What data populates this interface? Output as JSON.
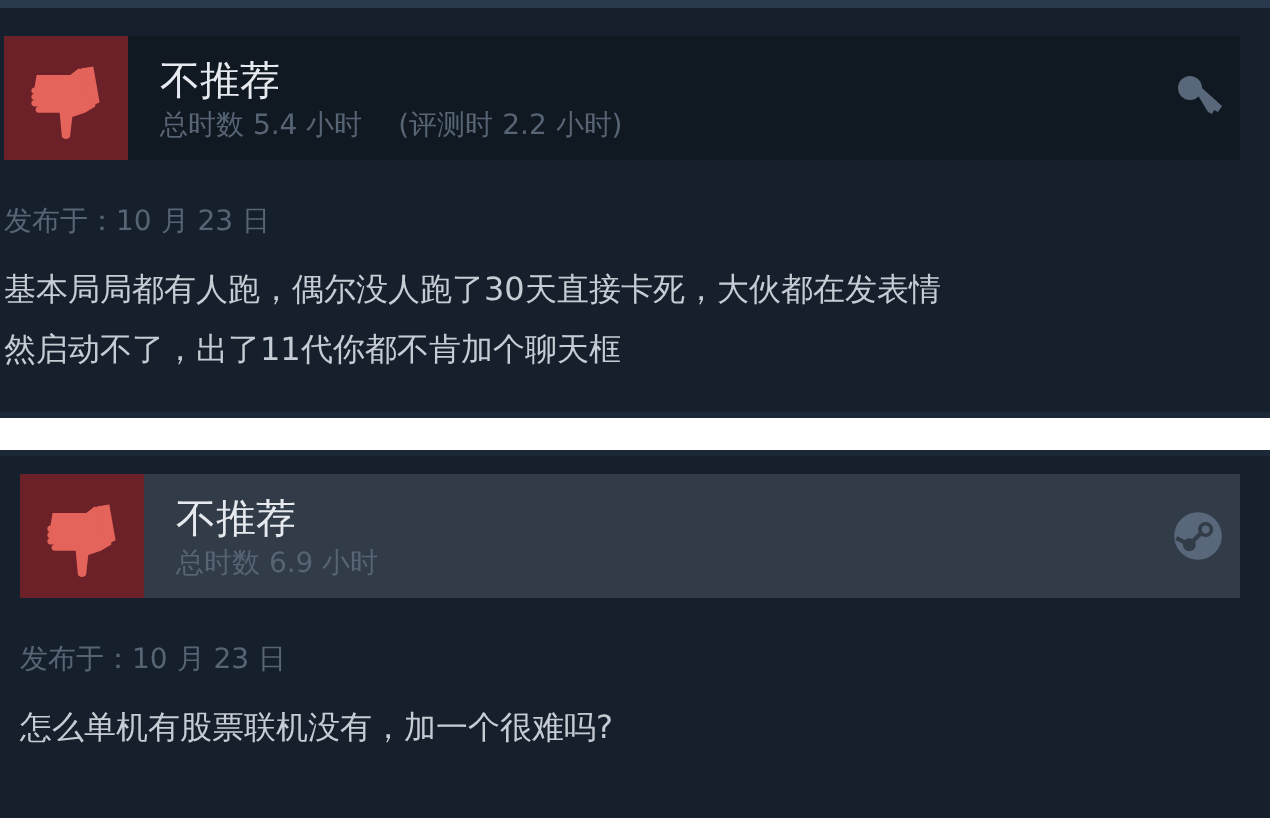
{
  "reviews": [
    {
      "verdict": "不推荐",
      "hours": "总时数 5.4 小时",
      "review_hours": "(评测时 2.2 小时)",
      "kind": "key",
      "highlighted": false,
      "date": "发布于：10 月 23 日",
      "body_lines": [
        "基本局局都有人跑，偶尔没人跑了30天直接卡死，大伙都在发表情",
        "然启动不了，出了11代你都不肯加个聊天框"
      ]
    },
    {
      "verdict": "不推荐",
      "hours": "总时数 6.9 小时",
      "kind": "steam",
      "highlighted": true,
      "date": "发布于：10 月 23 日",
      "body_lines": [
        "怎么单机有股票联机没有，加一个很难吗?"
      ]
    }
  ]
}
